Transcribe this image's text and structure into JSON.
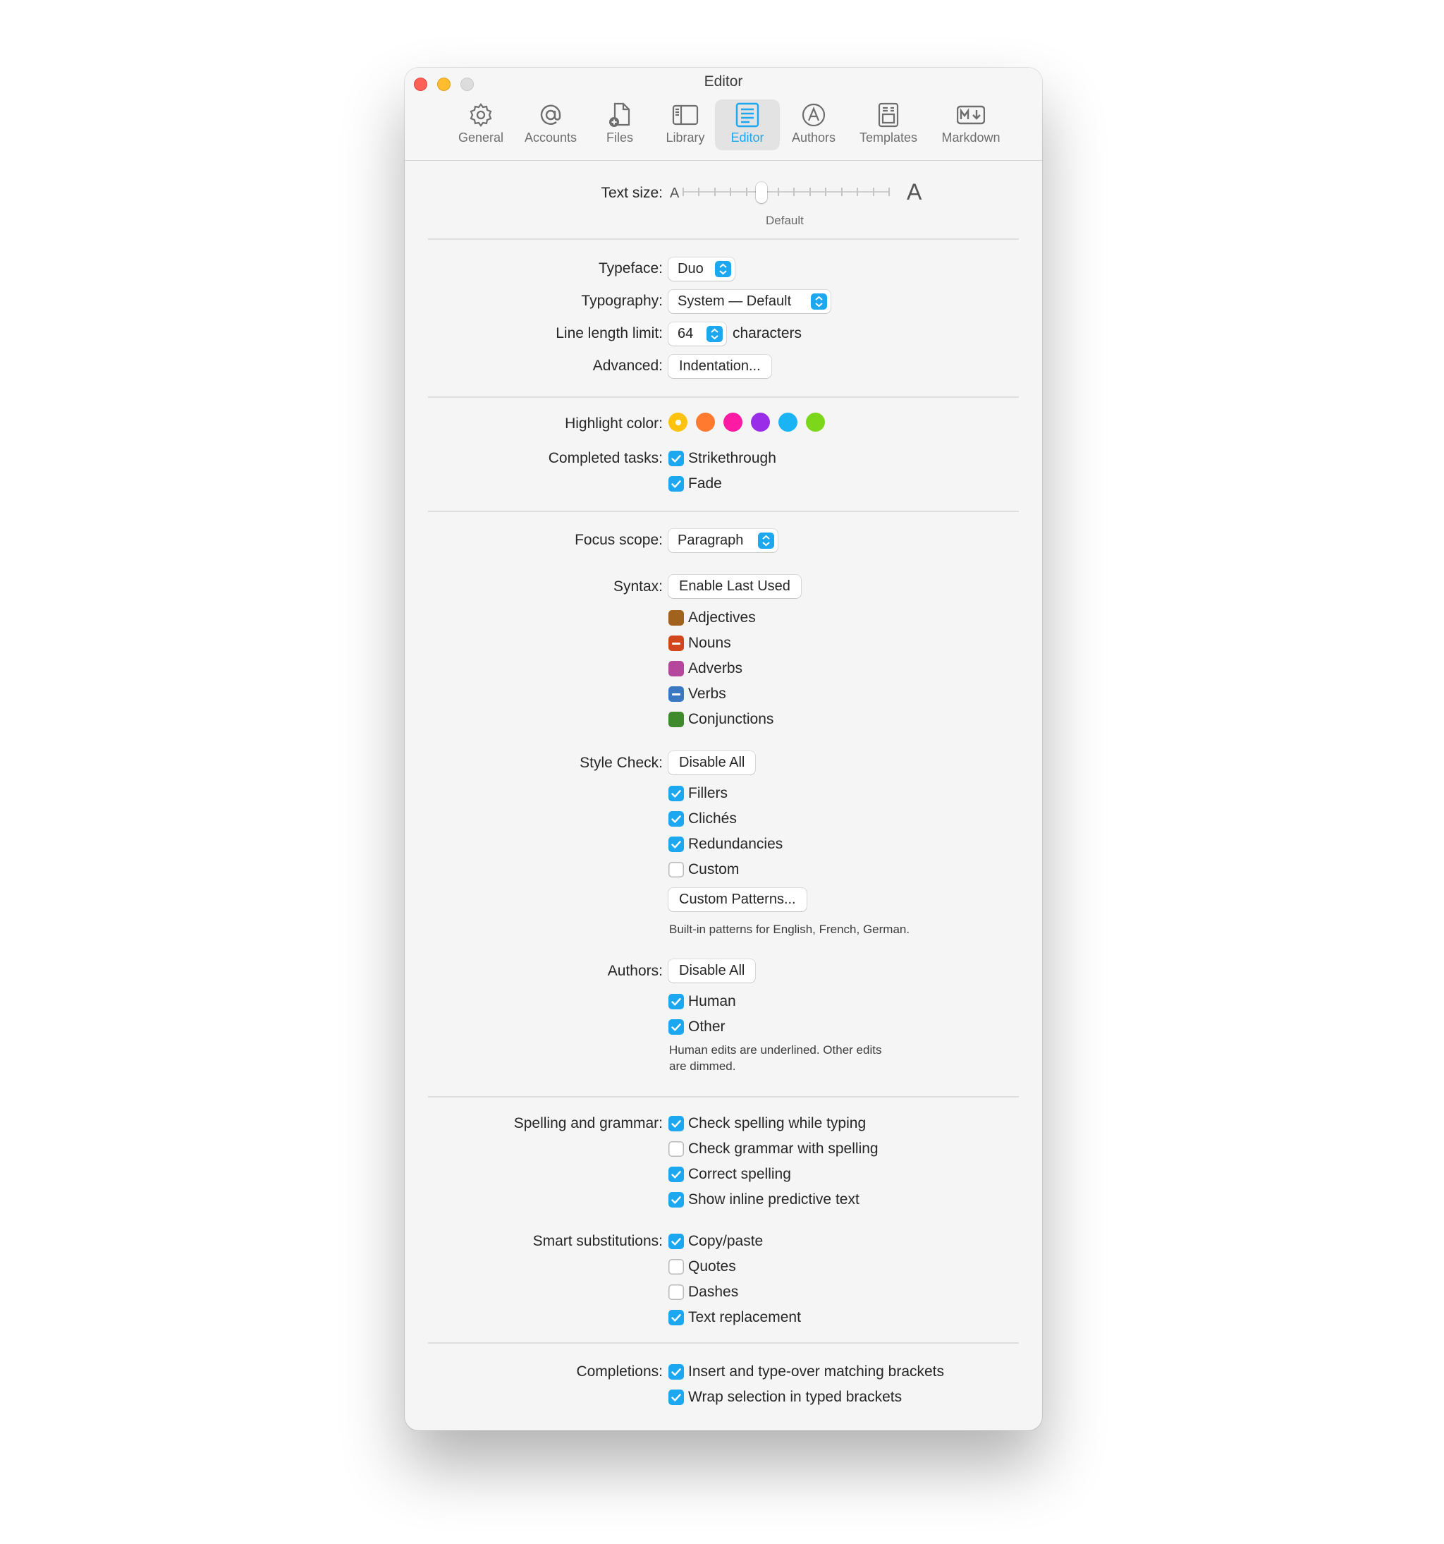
{
  "window": {
    "title": "Editor"
  },
  "toolbar": {
    "tabs": [
      {
        "label": "General",
        "icon": "gear-icon"
      },
      {
        "label": "Accounts",
        "icon": "at-sign-icon"
      },
      {
        "label": "Files",
        "icon": "file-add-icon"
      },
      {
        "label": "Library",
        "icon": "sidebar-icon"
      },
      {
        "label": "Editor",
        "icon": "editor-document-icon",
        "active": true
      },
      {
        "label": "Authors",
        "icon": "authors-circle-a-icon"
      },
      {
        "label": "Templates",
        "icon": "template-icon"
      },
      {
        "label": "Markdown",
        "icon": "markdown-icon"
      }
    ]
  },
  "text_size": {
    "label": "Text size:",
    "small_glyph": "A",
    "large_glyph": "A",
    "caption": "Default",
    "steps": 14,
    "selected_step": 5
  },
  "typeface": {
    "label": "Typeface:",
    "value": "Duo"
  },
  "typography": {
    "label": "Typography:",
    "value": "System — Default"
  },
  "line_length": {
    "label": "Line length limit:",
    "value": "64",
    "suffix": "characters"
  },
  "advanced": {
    "label": "Advanced:",
    "button": "Indentation..."
  },
  "highlight": {
    "label": "Highlight color:",
    "colors": [
      "#ffc20e",
      "#ff7a2f",
      "#ff1aa3",
      "#9a2ee8",
      "#1ab4f5",
      "#7cd61a"
    ],
    "selected_index": 0
  },
  "completed_tasks": {
    "label": "Completed tasks:",
    "options": [
      {
        "label": "Strikethrough",
        "checked": true
      },
      {
        "label": "Fade",
        "checked": true
      }
    ]
  },
  "focus_scope": {
    "label": "Focus scope:",
    "value": "Paragraph"
  },
  "syntax": {
    "label": "Syntax:",
    "button": "Enable Last Used",
    "items": [
      {
        "label": "Adjectives",
        "color": "#a0621c",
        "state": "on"
      },
      {
        "label": "Nouns",
        "color": "#d2461e",
        "state": "mixed"
      },
      {
        "label": "Adverbs",
        "color": "#b5489c",
        "state": "on"
      },
      {
        "label": "Verbs",
        "color": "#3a78c4",
        "state": "mixed"
      },
      {
        "label": "Conjunctions",
        "color": "#3f8a2c",
        "state": "on"
      }
    ]
  },
  "style_check": {
    "label": "Style Check:",
    "button": "Disable All",
    "options": [
      {
        "label": "Fillers",
        "checked": true
      },
      {
        "label": "Clichés",
        "checked": true
      },
      {
        "label": "Redundancies",
        "checked": true
      },
      {
        "label": "Custom",
        "checked": false
      }
    ],
    "patterns_button": "Custom Patterns...",
    "note": "Built-in patterns for English, French, German."
  },
  "authors": {
    "label": "Authors:",
    "button": "Disable All",
    "options": [
      {
        "label": "Human",
        "checked": true
      },
      {
        "label": "Other",
        "checked": true
      }
    ],
    "note_line1": "Human edits are underlined. Other edits",
    "note_line2": "are dimmed."
  },
  "spelling": {
    "label": "Spelling and grammar:",
    "options": [
      {
        "label": "Check spelling while typing",
        "checked": true
      },
      {
        "label": "Check grammar with spelling",
        "checked": false
      },
      {
        "label": "Correct spelling",
        "checked": true
      },
      {
        "label": "Show inline predictive text",
        "checked": true
      }
    ]
  },
  "smart": {
    "label": "Smart substitutions:",
    "options": [
      {
        "label": "Copy/paste",
        "checked": true
      },
      {
        "label": "Quotes",
        "checked": false
      },
      {
        "label": "Dashes",
        "checked": false
      },
      {
        "label": "Text replacement",
        "checked": true
      }
    ]
  },
  "completions": {
    "label": "Completions:",
    "options": [
      {
        "label": "Insert and type-over matching brackets",
        "checked": true
      },
      {
        "label": "Wrap selection in typed brackets",
        "checked": true
      }
    ]
  },
  "colors": {
    "accent": "#1ba8f0"
  }
}
